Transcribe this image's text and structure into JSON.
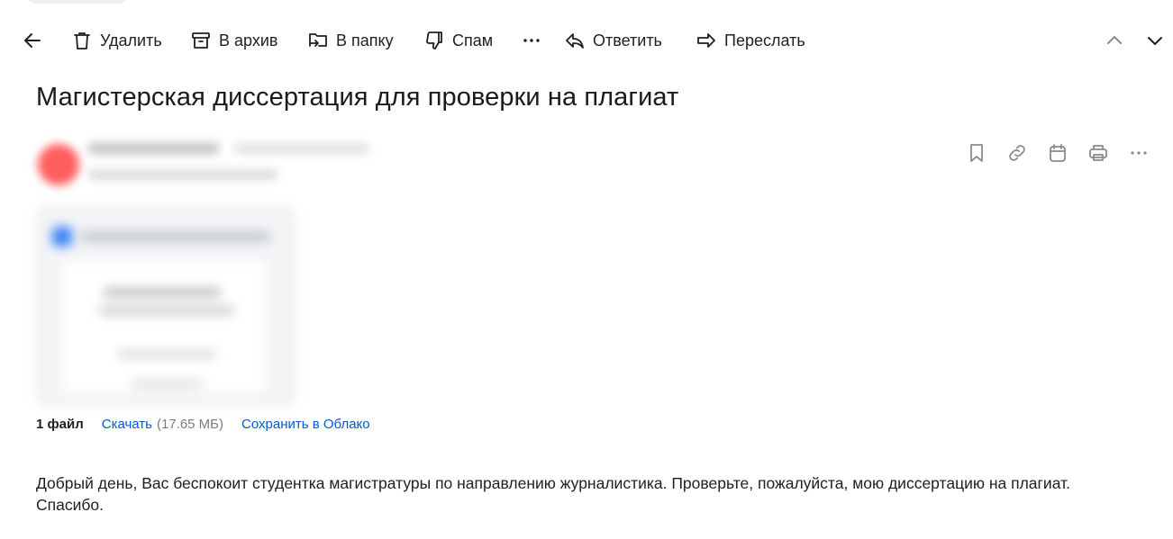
{
  "toolbar": {
    "delete_label": "Удалить",
    "archive_label": "В архив",
    "folder_label": "В папку",
    "spam_label": "Спам",
    "reply_label": "Ответить",
    "forward_label": "Переслать"
  },
  "email": {
    "subject": "Магистерская диссертация для проверки на плагиат",
    "attachment": {
      "count_label": "1 файл",
      "download_label": "Скачать",
      "size": "(17.65 МБ)",
      "save_cloud_label": "Сохранить в Облако"
    },
    "body": "Добрый день, Вас беспокоит студентка магистратуры по направлению журналистика. Проверьте, пожалуйста, мою диссертацию на плагиат. Спасибо."
  },
  "icons": {
    "back": "arrow-left-icon",
    "delete": "trash-icon",
    "archive": "archive-box-icon",
    "folder": "move-to-folder-icon",
    "spam": "thumbs-down-icon",
    "more": "more-horizontal-icon",
    "reply": "reply-icon",
    "forward": "forward-icon",
    "prev": "chevron-up-icon",
    "next": "chevron-down-icon",
    "bookmark": "bookmark-icon",
    "link": "link-icon",
    "calendar": "calendar-icon",
    "print": "printer-icon",
    "menu": "more-horizontal-icon"
  },
  "colors": {
    "link": "#005bd1",
    "avatar": "#ff5e5e",
    "muted": "#7d7d7d"
  }
}
